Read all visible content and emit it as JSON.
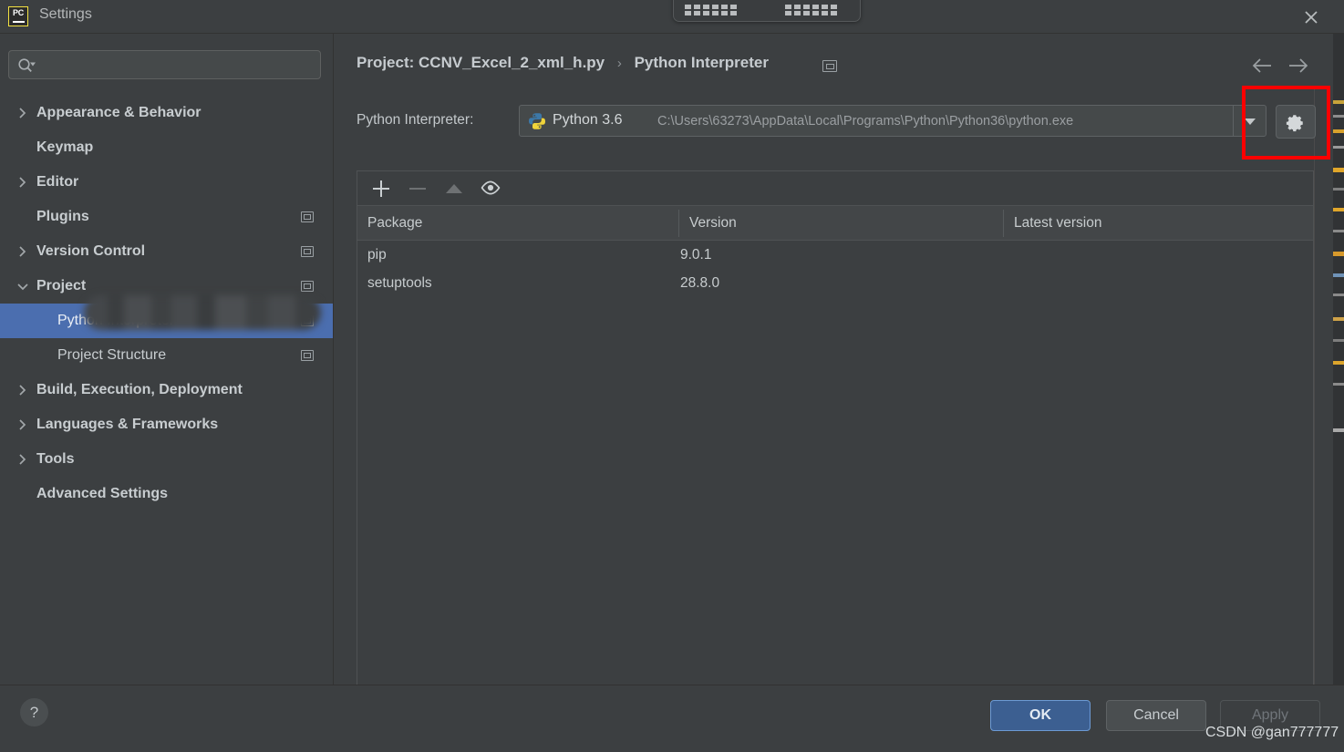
{
  "window": {
    "title": "Settings",
    "app_logo_text": "PC",
    "close_icon": "close-icon"
  },
  "search": {
    "value": "",
    "placeholder": "",
    "icon": "search-icon"
  },
  "sidebar": {
    "items": [
      {
        "label": "Appearance & Behavior",
        "level": 0,
        "expandable": true,
        "expanded": false,
        "badge": false,
        "selected": false
      },
      {
        "label": "Keymap",
        "level": 0,
        "expandable": false,
        "expanded": false,
        "badge": false,
        "selected": false
      },
      {
        "label": "Editor",
        "level": 0,
        "expandable": true,
        "expanded": false,
        "badge": false,
        "selected": false
      },
      {
        "label": "Plugins",
        "level": 0,
        "expandable": false,
        "expanded": false,
        "badge": true,
        "selected": false
      },
      {
        "label": "Version Control",
        "level": 0,
        "expandable": true,
        "expanded": false,
        "badge": true,
        "selected": false
      },
      {
        "label": "Project",
        "level": 0,
        "expandable": true,
        "expanded": true,
        "badge": true,
        "selected": false,
        "redacted": true
      },
      {
        "label": "Python Interpreter",
        "level": 1,
        "expandable": false,
        "expanded": false,
        "badge": true,
        "selected": true
      },
      {
        "label": "Project Structure",
        "level": 1,
        "expandable": false,
        "expanded": false,
        "badge": true,
        "selected": false
      },
      {
        "label": "Build, Execution, Deployment",
        "level": 0,
        "expandable": true,
        "expanded": false,
        "badge": false,
        "selected": false
      },
      {
        "label": "Languages & Frameworks",
        "level": 0,
        "expandable": true,
        "expanded": false,
        "badge": false,
        "selected": false
      },
      {
        "label": "Tools",
        "level": 0,
        "expandable": true,
        "expanded": false,
        "badge": false,
        "selected": false
      },
      {
        "label": "Advanced Settings",
        "level": 0,
        "expandable": false,
        "expanded": false,
        "badge": false,
        "selected": false
      }
    ]
  },
  "breadcrumb": {
    "root": "Project: CCNV_Excel_2_xml_h.py",
    "separator": "›",
    "current": "Python Interpreter"
  },
  "nav": {
    "back_icon": "arrow-left-icon",
    "forward_icon": "arrow-right-icon"
  },
  "interpreter": {
    "label": "Python Interpreter:",
    "selected_name": "Python 3.6",
    "selected_path": "C:\\Users\\63273\\AppData\\Local\\Programs\\Python\\Python36\\python.exe",
    "icon": "python-logo-icon",
    "dropdown_icon": "chevron-down-icon",
    "settings_icon": "gear-icon"
  },
  "packages": {
    "toolbar": [
      {
        "name": "add-package-button",
        "icon": "plus-icon",
        "enabled": true
      },
      {
        "name": "remove-package-button",
        "icon": "minus-icon",
        "enabled": false
      },
      {
        "name": "upgrade-package-button",
        "icon": "arrow-up-icon",
        "enabled": false
      },
      {
        "name": "show-early-releases-button",
        "icon": "eye-icon",
        "enabled": true
      }
    ],
    "columns": [
      "Package",
      "Version",
      "Latest version"
    ],
    "rows": [
      {
        "package": "pip",
        "version": "9.0.1",
        "latest": ""
      },
      {
        "package": "setuptools",
        "version": "28.8.0",
        "latest": ""
      }
    ]
  },
  "footer": {
    "help_label": "?",
    "ok_label": "OK",
    "cancel_label": "Cancel",
    "apply_label": "Apply"
  },
  "watermark": {
    "text": "CSDN @gan777777"
  },
  "colors": {
    "background": "#3c3f41",
    "selection": "#4b6eaf",
    "annotation": "#fe0000",
    "primary_button": "#3c5f91",
    "python_blue": "#3c78a8",
    "python_yellow": "#f0d43a"
  }
}
